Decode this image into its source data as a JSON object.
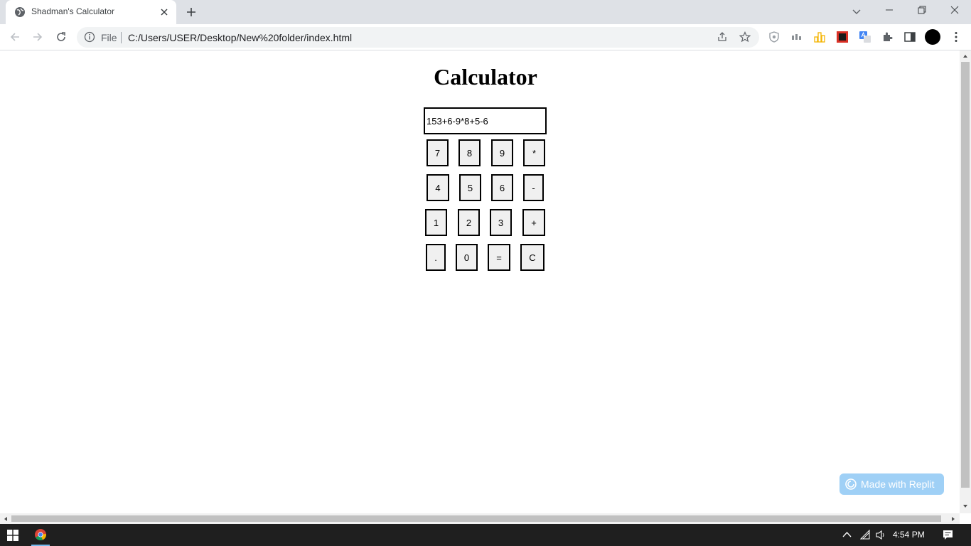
{
  "browser": {
    "tab_title": "Shadman's Calculator",
    "omnibox_scheme_label": "File",
    "url": "C:/Users/USER/Desktop/New%20folder/index.html"
  },
  "page": {
    "title": "Calculator",
    "display_value": "153+6-9*8+5-6",
    "keys": {
      "k7": "7",
      "k8": "8",
      "k9": "9",
      "kmul": "*",
      "k4": "4",
      "k5": "5",
      "k6": "6",
      "kminus": "-",
      "k1": "1",
      "k2": "2",
      "k3": "3",
      "kplus": "+",
      "kdot": ".",
      "k0": "0",
      "keq": "=",
      "kclear": "C"
    },
    "replit_badge": "Made with Replit"
  },
  "taskbar": {
    "clock": "4:54 PM"
  },
  "colors": {
    "tab_strip": "#dee1e6",
    "omnibox": "#f1f3f4",
    "key_face": "#f0f0f0",
    "replit_badge": "#9fd0f6",
    "taskbar": "#1f1f1f"
  }
}
